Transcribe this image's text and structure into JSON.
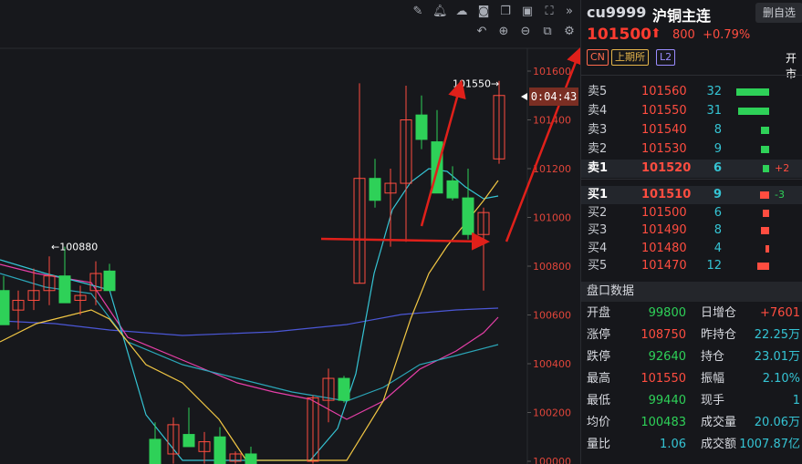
{
  "toolbar": {
    "icons": [
      "pencil-icon",
      "bell-icon",
      "cloud-icon",
      "camera-icon",
      "copy-icon",
      "monitor-icon",
      "fullscreen-icon",
      "collapse-icon"
    ],
    "icons2": [
      "undo-icon",
      "zoom-in-icon",
      "zoom-out-icon",
      "layout-icon",
      "settings-icon"
    ]
  },
  "chart": {
    "y_ticks": [
      "101600",
      "101400",
      "101200",
      "101000",
      "100800",
      "100600",
      "100400",
      "100200",
      "100000"
    ],
    "high_label": "101550→",
    "low_label": "←100880",
    "countdown": "0:04:43",
    "colors": {
      "up": "#ff4d40",
      "down": "#2ed158",
      "ma_yellow": "#f2c744",
      "ma_cyan": "#35c4d4",
      "ma_blue": "#4b57d6",
      "ma_pink": "#e63fa8",
      "ma_teal": "#2ba6b8",
      "arrow": "#e0201a"
    }
  },
  "chart_data": {
    "type": "candlestick",
    "ylim": [
      100000,
      101650
    ],
    "candles": [
      {
        "o": 100700,
        "h": 100760,
        "l": 100560,
        "c": 100560
      },
      {
        "o": 100620,
        "h": 100700,
        "l": 100540,
        "c": 100660
      },
      {
        "o": 100660,
        "h": 100790,
        "l": 100620,
        "c": 100700
      },
      {
        "o": 100700,
        "h": 100840,
        "l": 100640,
        "c": 100760
      },
      {
        "o": 100760,
        "h": 100880,
        "l": 100660,
        "c": 100650
      },
      {
        "o": 100660,
        "h": 100720,
        "l": 100600,
        "c": 100680
      },
      {
        "o": 100700,
        "h": 100820,
        "l": 100640,
        "c": 100770
      },
      {
        "o": 100780,
        "h": 100810,
        "l": 100700,
        "c": 100700
      },
      {
        "o": 100090,
        "h": 100160,
        "l": 99990,
        "c": 99990
      },
      {
        "o": 100030,
        "h": 100180,
        "l": 99990,
        "c": 100150
      },
      {
        "o": 100110,
        "h": 100220,
        "l": 100060,
        "c": 100060
      },
      {
        "o": 100040,
        "h": 100120,
        "l": 99990,
        "c": 100080
      },
      {
        "o": 100100,
        "h": 100140,
        "l": 99990,
        "c": 99990
      },
      {
        "o": 100000,
        "h": 100040,
        "l": 99990,
        "c": 100030
      },
      {
        "o": 100030,
        "h": 100060,
        "l": 99990,
        "c": 99990
      },
      {
        "o": 100000,
        "h": 100270,
        "l": 99990,
        "c": 100260
      },
      {
        "o": 100250,
        "h": 100380,
        "l": 100160,
        "c": 100340
      },
      {
        "o": 100340,
        "h": 100350,
        "l": 100240,
        "c": 100250
      },
      {
        "o": 100730,
        "h": 101550,
        "l": 100730,
        "c": 101160
      },
      {
        "o": 101160,
        "h": 101240,
        "l": 101040,
        "c": 101070
      },
      {
        "o": 101100,
        "h": 101200,
        "l": 100880,
        "c": 101140
      },
      {
        "o": 101140,
        "h": 101540,
        "l": 100900,
        "c": 101400
      },
      {
        "o": 101420,
        "h": 101500,
        "l": 101280,
        "c": 101320
      },
      {
        "o": 101310,
        "h": 101440,
        "l": 101120,
        "c": 101100
      },
      {
        "o": 101150,
        "h": 101210,
        "l": 101070,
        "c": 101080
      },
      {
        "o": 101080,
        "h": 101200,
        "l": 100910,
        "c": 100930
      },
      {
        "o": 100930,
        "h": 101040,
        "l": 100700,
        "c": 101020
      },
      {
        "o": 101240,
        "h": 101560,
        "l": 101220,
        "c": 101500
      }
    ]
  },
  "header": {
    "code": "cu9999",
    "name": "沪铜主连",
    "watch_button": "删自选",
    "price": "101500",
    "change": "800",
    "change_pct": "+0.79%",
    "tag_cn": "CN",
    "tag_exchange": "上期所",
    "tag_level": "L2",
    "open_hint": "开市"
  },
  "order_book": {
    "asks": [
      {
        "label": "卖5",
        "price": "101560",
        "vol": "32",
        "bar": 36,
        "delta": ""
      },
      {
        "label": "卖4",
        "price": "101550",
        "vol": "31",
        "bar": 34,
        "delta": ""
      },
      {
        "label": "卖3",
        "price": "101540",
        "vol": "8",
        "bar": 9,
        "delta": ""
      },
      {
        "label": "卖2",
        "price": "101530",
        "vol": "9",
        "bar": 9,
        "delta": ""
      },
      {
        "label": "卖1",
        "price": "101520",
        "vol": "6",
        "bar": 7,
        "delta": "+2"
      }
    ],
    "bids": [
      {
        "label": "买1",
        "price": "101510",
        "vol": "9",
        "bar": 10,
        "delta": "-3"
      },
      {
        "label": "买2",
        "price": "101500",
        "vol": "6",
        "bar": 7,
        "delta": ""
      },
      {
        "label": "买3",
        "price": "101490",
        "vol": "8",
        "bar": 9,
        "delta": ""
      },
      {
        "label": "买4",
        "price": "101480",
        "vol": "4",
        "bar": 4,
        "delta": ""
      },
      {
        "label": "买5",
        "price": "101470",
        "vol": "12",
        "bar": 13,
        "delta": ""
      }
    ]
  },
  "stats": {
    "title": "盘口数据",
    "rows": [
      {
        "l1": "开盘",
        "v1": "99800",
        "c1": "green",
        "l2": "日增仓",
        "v2": "+7601",
        "c2": "red"
      },
      {
        "l1": "涨停",
        "v1": "108750",
        "c1": "red",
        "l2": "昨持仓",
        "v2": "22.25万",
        "c2": "cyan"
      },
      {
        "l1": "跌停",
        "v1": "92640",
        "c1": "green",
        "l2": "持仓",
        "v2": "23.01万",
        "c2": "cyan"
      },
      {
        "l1": "最高",
        "v1": "101550",
        "c1": "red",
        "l2": "振幅",
        "v2": "2.10%",
        "c2": "cyan"
      },
      {
        "l1": "最低",
        "v1": "99440",
        "c1": "green",
        "l2": "现手",
        "v2": "1",
        "c2": "cyan"
      },
      {
        "l1": "均价",
        "v1": "100483",
        "c1": "green",
        "l2": "成交量",
        "v2": "20.06万",
        "c2": "cyan"
      },
      {
        "l1": "量比",
        "v1": "1.06",
        "c1": "cyan",
        "l2": "成交额",
        "v2": "1007.87亿",
        "c2": "cyan"
      }
    ]
  }
}
